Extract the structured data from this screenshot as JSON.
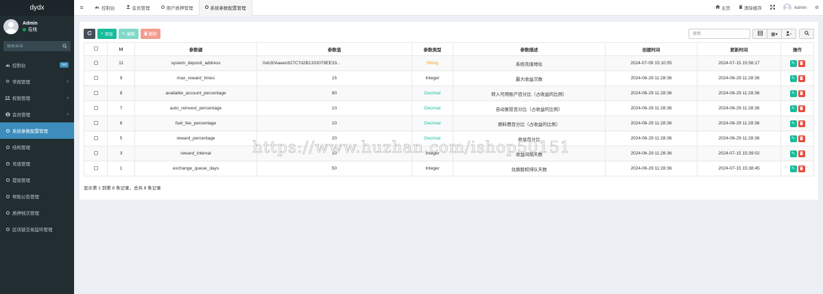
{
  "brand": "dydx",
  "user": {
    "name": "Admin",
    "status": "在线"
  },
  "sidebar": {
    "search_placeholder": "搜索菜单",
    "items": [
      {
        "label": "控制台",
        "icon": "dashboard-icon",
        "badge": "hot"
      },
      {
        "label": "常规管理",
        "icon": "cogs-icon"
      },
      {
        "label": "权限管理",
        "icon": "group-icon"
      },
      {
        "label": "会员管理",
        "icon": "user-circle-icon"
      },
      {
        "label": "系统参数配置管理",
        "icon": "circle-icon"
      },
      {
        "label": "结构管理",
        "icon": "circle-icon"
      },
      {
        "label": "充值管理",
        "icon": "circle-icon"
      },
      {
        "label": "提现管理",
        "icon": "circle-icon"
      },
      {
        "label": "帮助公告管理",
        "icon": "circle-icon"
      },
      {
        "label": "质押档次管理",
        "icon": "circle-icon"
      },
      {
        "label": "区块链交易监听管理",
        "icon": "circle-icon"
      }
    ],
    "active_index": 4
  },
  "topbar": {
    "tabs": [
      {
        "label": "控制台",
        "icon": "dashboard-icon"
      },
      {
        "label": "会员管理",
        "icon": "user-icon"
      },
      {
        "label": "用户质押管理",
        "icon": "circle-icon"
      },
      {
        "label": "系统参数配置管理",
        "icon": "circle-icon"
      }
    ],
    "home_label": "主页",
    "clear_cache_label": "清除缓存",
    "admin_label": "Admin"
  },
  "toolbar": {
    "add_label": "添加",
    "edit_label": "编辑",
    "delete_label": "删除",
    "search_placeholder": "搜索"
  },
  "table": {
    "headers": [
      "Id",
      "参数键",
      "参数值",
      "参数类型",
      "参数描述",
      "创建时间",
      "更新时间",
      "操作"
    ],
    "rows": [
      {
        "id": "11",
        "key": "system_deposit_address",
        "value": "0xb30Aaeec827C7d2B1333079EE33...",
        "type": "String",
        "desc": "系统充值地址",
        "created": "2024-07-09 15:10:55",
        "updated": "2024-07-15 15:56:17"
      },
      {
        "id": "9",
        "key": "max_reward_times",
        "value": "15",
        "type": "Integer",
        "desc": "最大收益次数",
        "created": "2024-06-29 11:28:36",
        "updated": "2024-06-29 11:28:36"
      },
      {
        "id": "8",
        "key": "available_account_percentage",
        "value": "80",
        "type": "Decimal",
        "desc": "转入可用账户百分比（占收益的比例）",
        "created": "2024-06-29 11:28:36",
        "updated": "2024-06-29 11:28:36"
      },
      {
        "id": "7",
        "key": "auto_reinvest_percentage",
        "value": "10",
        "type": "Decimal",
        "desc": "自动复投百分比（占收益的比例）",
        "created": "2024-06-29 11:28:36",
        "updated": "2024-06-29 11:28:36"
      },
      {
        "id": "6",
        "key": "fuel_fee_percentage",
        "value": "10",
        "type": "Decimal",
        "desc": "燃料费百分比（占收益的比例）",
        "created": "2024-06-29 11:28:36",
        "updated": "2024-06-29 11:28:36"
      },
      {
        "id": "5",
        "key": "reward_percentage",
        "value": "20",
        "type": "Decimal",
        "desc": "收益百分比",
        "created": "2024-06-29 11:28:36",
        "updated": "2024-06-29 11:28:36"
      },
      {
        "id": "3",
        "key": "reward_interval",
        "value": "10",
        "type": "Integer",
        "desc": "收益间隔天数",
        "created": "2024-06-29 11:28:36",
        "updated": "2024-07-15 15:39:02"
      },
      {
        "id": "1",
        "key": "exchange_queue_days",
        "value": "50",
        "type": "Integer",
        "desc": "兑换股权排队天数",
        "created": "2024-06-29 11:28:36",
        "updated": "2024-07-15 15:38:45"
      }
    ]
  },
  "pagination_info": "显示第 1 到第 8 条记录，总共 8 条记录",
  "watermark": "https://www.huzhan.com/ishop50151",
  "colors": {
    "primary": "#3c8dbc",
    "success": "#18bc9c",
    "danger": "#e74c3c",
    "warning": "#f39c12",
    "sidebar": "#222d32"
  }
}
